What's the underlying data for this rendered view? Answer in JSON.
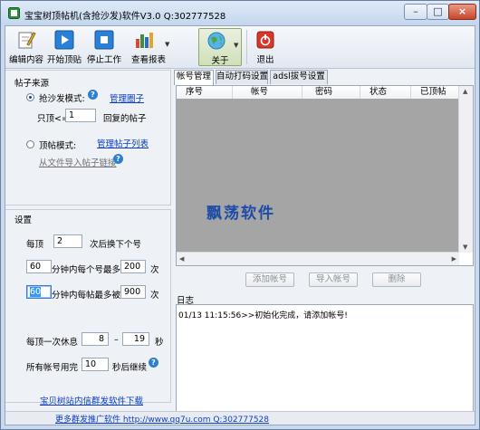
{
  "window": {
    "title": "宝宝树顶帖机(含抢沙发)软件V3.0 Q:302777528",
    "buttons": {
      "minimize": "–",
      "maximize": "□",
      "close": "×"
    }
  },
  "toolbar": {
    "items": [
      {
        "label": "编辑内容",
        "icon": "pencil-icon"
      },
      {
        "label": "开始顶贴",
        "icon": "play-icon"
      },
      {
        "label": "停止工作",
        "icon": "stop-icon"
      },
      {
        "label": "查看报表",
        "icon": "chart-icon"
      },
      {
        "label": "关于",
        "icon": "globe-icon"
      },
      {
        "label": "退出",
        "icon": "power-icon"
      }
    ]
  },
  "source": {
    "title": "帖子来源",
    "mode1_label": "抢沙发模式:",
    "mode1_link": "管理圈子",
    "only_top_prefix": "只顶<=",
    "only_top_value": "1",
    "only_top_suffix": "回复的帖子",
    "mode2_label": "顶帖模式:",
    "mode2_link": "管理帖子列表",
    "import_link": "从文件导入帖子链接"
  },
  "settings": {
    "title": "设置",
    "every_top_prefix": "每顶",
    "every_top_value": "2",
    "every_top_suffix": "次后换下个号",
    "minutes1_value": "60",
    "minutes1_mid": "分钟内每个号最多顶",
    "max1_value": "200",
    "max1_suffix": "次",
    "minutes2_value": "60",
    "minutes2_mid": "分钟内每帖最多被顶",
    "max2_value": "900",
    "max2_suffix": "次",
    "rest_prefix": "每顶一次休息",
    "rest_from": "8",
    "rest_dash": "–",
    "rest_to": "19",
    "rest_unit": "秒",
    "all_used_prefix": "所有帐号用完",
    "all_used_value": "10",
    "all_used_suffix": "秒后继续",
    "download_link": "宝贝树站内信群发软件下载"
  },
  "tabs": [
    "帐号管理",
    "自动打码设置",
    "adsl拔号设置"
  ],
  "accounts": {
    "columns": [
      "序号",
      "帐号",
      "密码",
      "状态",
      "已顶帖"
    ],
    "rows": [],
    "watermark": "飘荡软件"
  },
  "account_buttons": {
    "add": "添加帐号",
    "import": "导入帐号",
    "delete": "删除"
  },
  "log": {
    "title": "日志",
    "lines": [
      "01/13 11:15:56>>初始化完成，请添加帐号!"
    ]
  },
  "status": {
    "text": "更多群发推广软件 http://www.qq7u.com Q:302777528"
  },
  "colors": {
    "link": "#0b3ec4",
    "title_bg": "#c9d9ee",
    "grid_bg": "#a5a5a5"
  }
}
